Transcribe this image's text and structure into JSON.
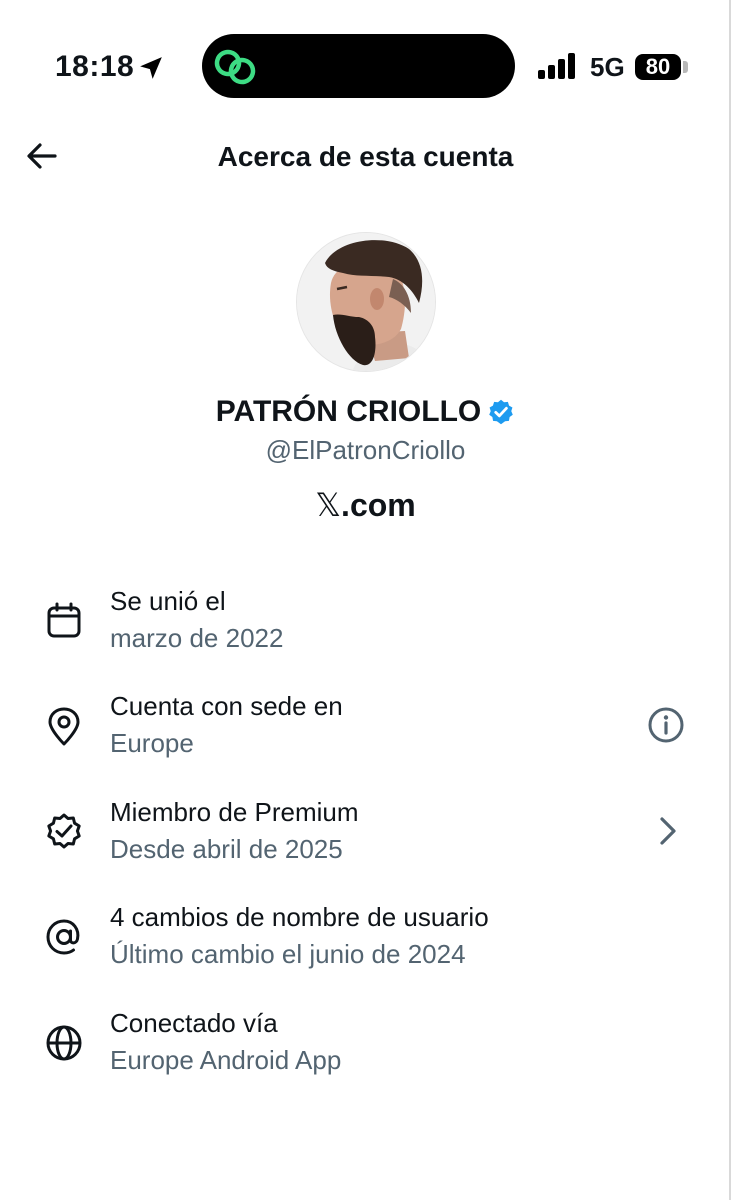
{
  "status_bar": {
    "time": "18:18",
    "network": "5G",
    "battery": "80",
    "icons": [
      "location-arrow-icon",
      "link-icon",
      "signal-icon",
      "battery-icon"
    ]
  },
  "header": {
    "title": "Acerca de esta cuenta",
    "back_icon": "back-arrow-icon"
  },
  "profile": {
    "name": "PATRÓN CRIOLLO",
    "handle": "@ElPatronCriollo",
    "platform_symbol": "𝕏",
    "platform_suffix": ".com",
    "verified_color": "#1d9bf0"
  },
  "rows": [
    {
      "icon": "calendar-icon",
      "title": "Se unió el",
      "subtitle": "marzo de 2022"
    },
    {
      "icon": "location-pin-icon",
      "title": "Cuenta con sede en",
      "subtitle": "Europe",
      "action_icon": "info-icon"
    },
    {
      "icon": "verified-badge-icon",
      "title": "Miembro de Premium",
      "subtitle": "Desde abril de 2025",
      "action_icon": "chevron-right-icon"
    },
    {
      "icon": "at-sign-icon",
      "title": "4 cambios de nombre de usuario",
      "subtitle": "Último cambio el junio de 2024"
    },
    {
      "icon": "globe-icon",
      "title": "Conectado vía",
      "subtitle": "Europe Android App"
    }
  ],
  "colors": {
    "text_primary": "#0f1419",
    "text_secondary": "#536471",
    "island_accent": "#3ddc84"
  }
}
